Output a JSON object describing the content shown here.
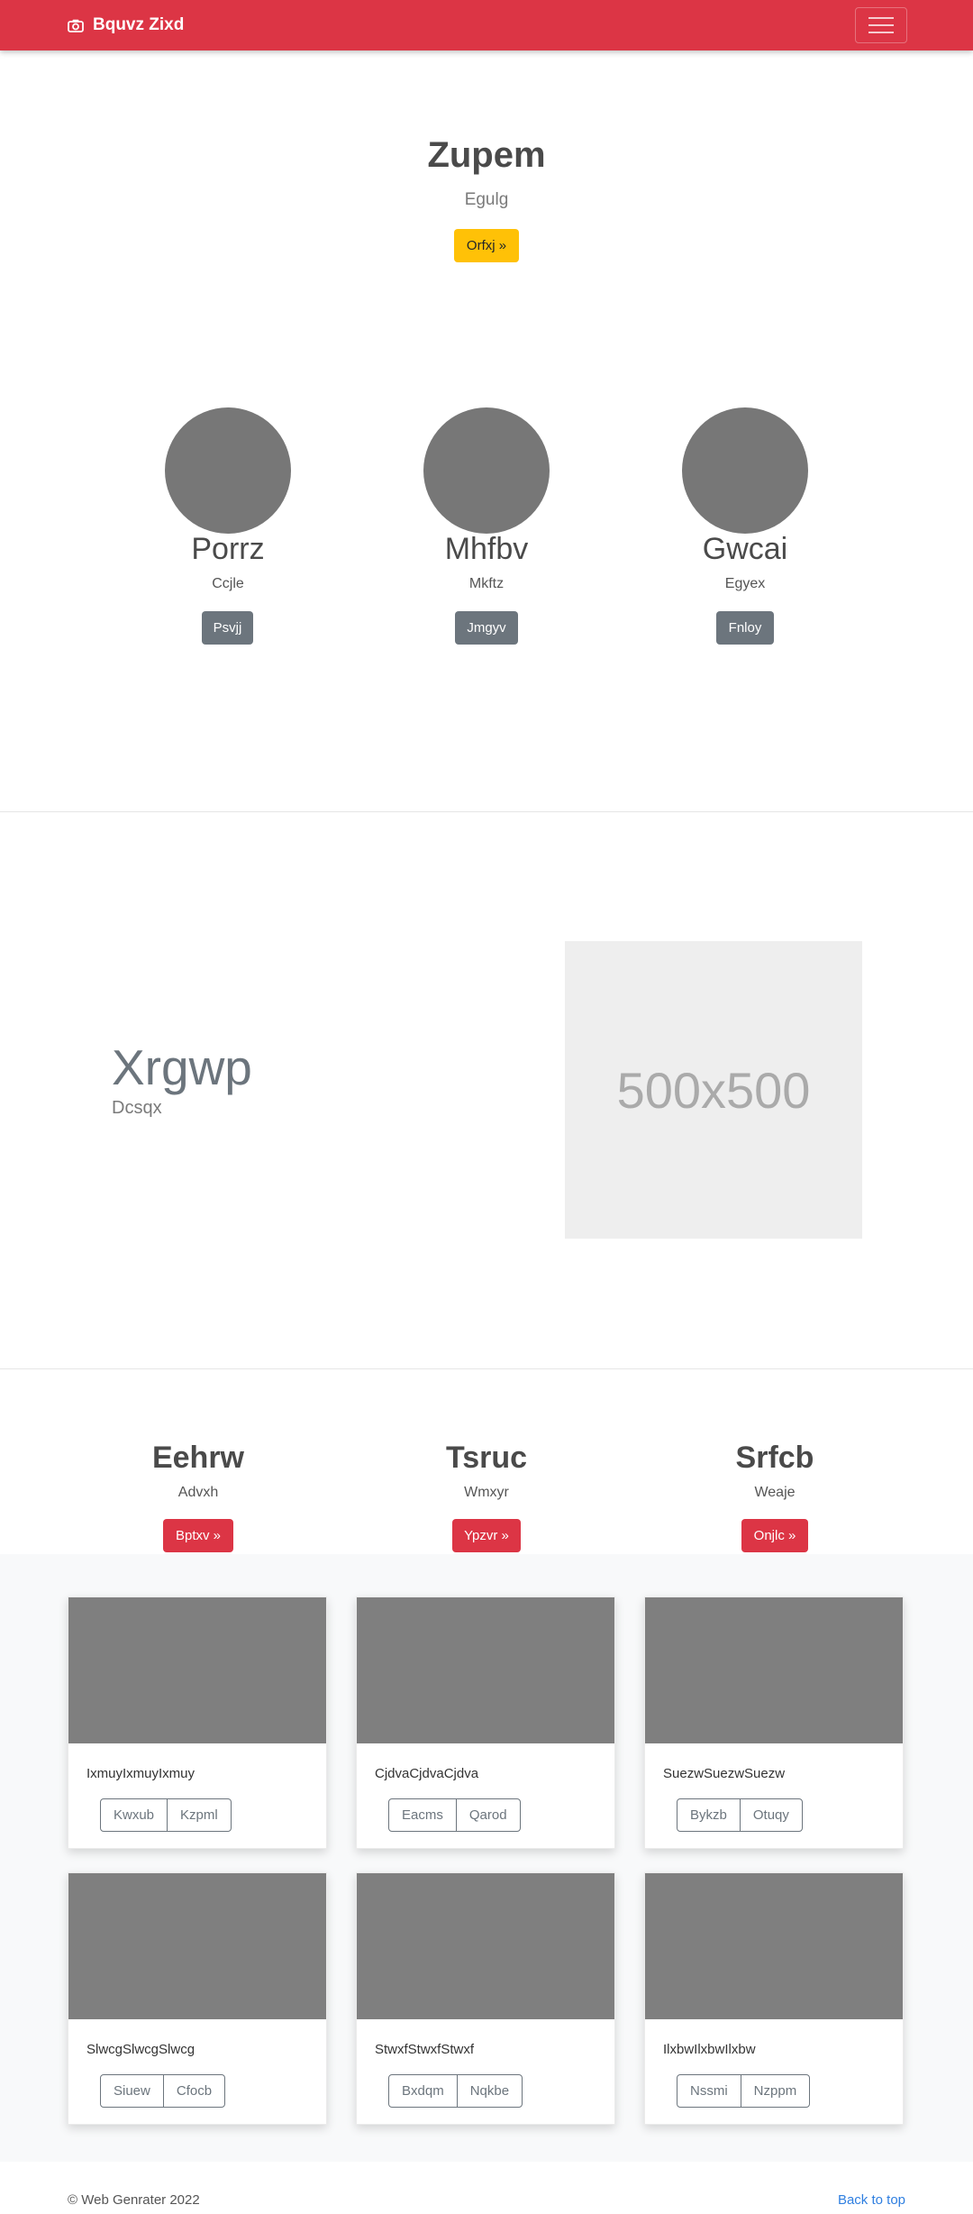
{
  "navbar": {
    "brand": "Bquvz Zixd",
    "brand_icon": "camera-icon"
  },
  "hero": {
    "title": "Zupem",
    "subtitle": "Egulg",
    "button": "Orfxj »",
    "button_color": "#ffc107"
  },
  "profiles": [
    {
      "name": "Porrz",
      "sub": "Ccjle",
      "button": "Psvjj"
    },
    {
      "name": "Mhfbv",
      "sub": "Mkftz",
      "button": "Jmgyv"
    },
    {
      "name": "Gwcai",
      "sub": "Egyex",
      "button": "Fnloy"
    }
  ],
  "feature": {
    "title": "Xrgwp",
    "subtitle": "Dcsqx",
    "placeholder": "500x500"
  },
  "columns": [
    {
      "title": "Eehrw",
      "sub": "Advxh",
      "button": "Bptxv »"
    },
    {
      "title": "Tsruc",
      "sub": "Wmxyr",
      "button": "Ypzvr »"
    },
    {
      "title": "Srfcb",
      "sub": "Weaje",
      "button": "Onjlc »"
    }
  ],
  "cards": [
    {
      "text": "IxmuyIxmuyIxmuy",
      "buttons": [
        "Kwxub",
        "Kzpml"
      ]
    },
    {
      "text": "CjdvaCjdvaCjdva",
      "buttons": [
        "Eacms",
        "Qarod"
      ]
    },
    {
      "text": "SuezwSuezwSuezw",
      "buttons": [
        "Bykzb",
        "Otuqy"
      ]
    },
    {
      "text": "SlwcgSlwcgSlwcg",
      "buttons": [
        "Siuew",
        "Cfocb"
      ]
    },
    {
      "text": "StwxfStwxfStwxf",
      "buttons": [
        "Bxdqm",
        "Nqkbe"
      ]
    },
    {
      "text": "IlxbwIlxbwIlxbw",
      "buttons": [
        "Nssmi",
        "Nzppm"
      ]
    }
  ],
  "footer": {
    "copyright": "© Web Genrater 2022",
    "back_to_top": "Back to top"
  },
  "colors": {
    "primary": "#dc3545",
    "warning": "#ffc107",
    "secondary": "#6c757d",
    "link": "#2f7fe0"
  }
}
